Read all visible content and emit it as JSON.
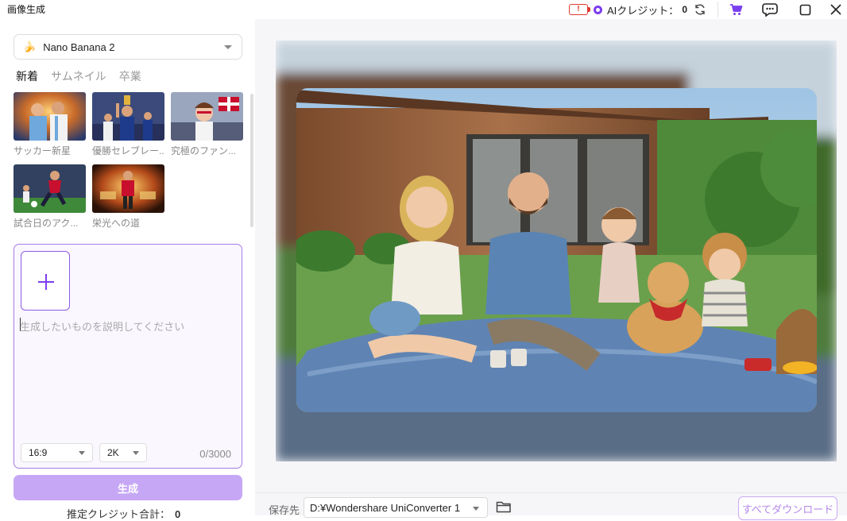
{
  "window": {
    "title": "画像生成"
  },
  "header": {
    "credit_label": "AIクレジット：",
    "credit_value": "0",
    "icons": [
      "battery-badge-icon",
      "ai-credit-icon",
      "refresh-icon",
      "cart-icon",
      "chat-icon",
      "maximize-icon",
      "close-icon"
    ],
    "accent": "#7a3df0"
  },
  "model": {
    "emoji": "🍌",
    "name": "Nano Banana 2"
  },
  "tabs": [
    {
      "label": "新着",
      "active": true
    },
    {
      "label": "サムネイル",
      "active": false
    },
    {
      "label": "卒業",
      "active": false
    }
  ],
  "templates": [
    {
      "caption": "サッカー新星"
    },
    {
      "caption": "優勝セレブレー..."
    },
    {
      "caption": "究極のファン..."
    },
    {
      "caption": "試合日のアク..."
    },
    {
      "caption": "栄光への道"
    }
  ],
  "prompt": {
    "placeholder": "生成したいものを説明してください",
    "aspect": "16:9",
    "resolution": "2K",
    "counter": "0/3000"
  },
  "generate_label": "生成",
  "estimate": {
    "label": "推定クレジット合計：",
    "value": "0"
  },
  "footer": {
    "save_label": "保存先",
    "path": "D:¥Wondershare UniConverter 1",
    "download_label": "すべてダウンロード"
  }
}
